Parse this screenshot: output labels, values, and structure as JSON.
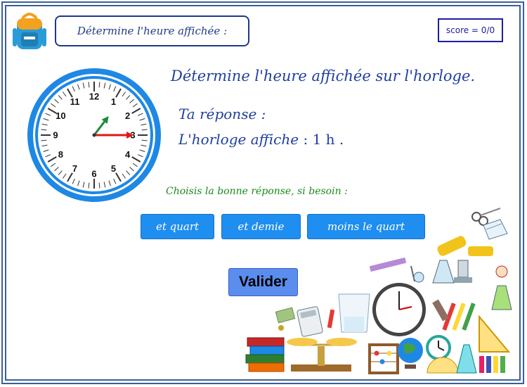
{
  "header": {
    "title": "Détermine l'heure affichée :",
    "score": "score = 0/0"
  },
  "clock": {
    "numbers": [
      "12",
      "1",
      "2",
      "3",
      "4",
      "5",
      "6",
      "7",
      "8",
      "9",
      "10",
      "11"
    ],
    "hour_value": 1,
    "minute_value": 15
  },
  "exercise": {
    "question": "Détermine l'heure affichée sur l'horloge.",
    "answer_label": "Ta réponse :",
    "answer_prefix": "L'horloge affiche",
    "answer_value": ": 1 h .",
    "hint": "Choisis la bonne réponse, si besoin :"
  },
  "choices": [
    {
      "label": "et quart"
    },
    {
      "label": "et demie"
    },
    {
      "label": "moins le quart"
    }
  ],
  "submit_label": "Valider",
  "colors": {
    "frame": "#3a5f99",
    "text_blue": "#1f3f9f",
    "hint_green": "#1a8a1a",
    "button": "#1f8ef1",
    "valider": "#5b8def",
    "clock_ring": "#1e88e5",
    "hour_hand": "#1a8a3a",
    "minute_hand": "#e01818"
  }
}
